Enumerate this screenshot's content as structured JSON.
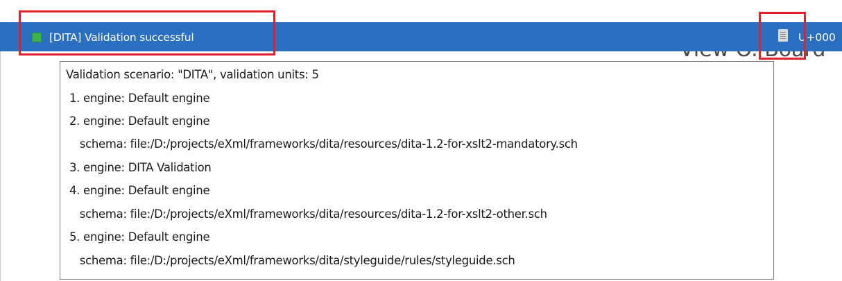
{
  "status_bar": {
    "indicator_color": "#39b54a",
    "validation_status": "[DITA] Validation successful",
    "details_icon": "document-icon",
    "encoding_fragment": "U+000"
  },
  "background": {
    "heading_fragment": "View O. Board"
  },
  "tooltip": {
    "lines": [
      "Validation scenario: \"DITA\", validation units: 5",
      " 1. engine: Default engine",
      " 2. engine: Default engine",
      "    schema: file:/D:/projects/eXml/frameworks/dita/resources/dita-1.2-for-xslt2-mandatory.sch",
      " 3. engine: DITA Validation",
      " 4. engine: Default engine",
      "    schema: file:/D:/projects/eXml/frameworks/dita/resources/dita-1.2-for-xslt2-other.sch",
      " 5. engine: Default engine",
      "    schema: file:/D:/projects/eXml/frameworks/dita/styleguide/rules/styleguide.sch"
    ]
  },
  "highlight_color": "#e0202a"
}
